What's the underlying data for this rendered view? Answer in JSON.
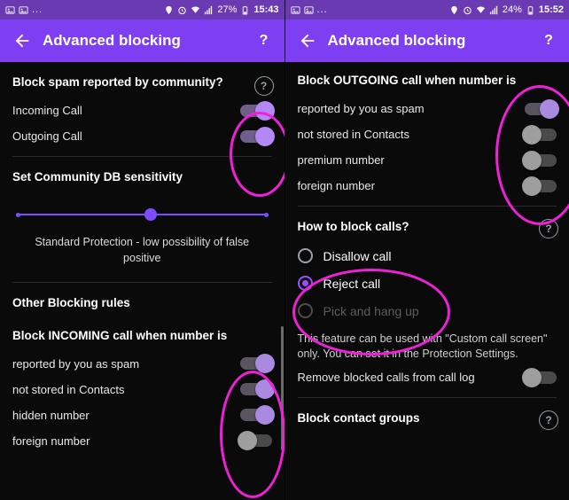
{
  "left_phone": {
    "statusbar": {
      "icons_left": [
        "image-icon",
        "image-icon",
        "overflow-dots-icon"
      ],
      "dots": "...",
      "icons_right": [
        "location-icon",
        "alarm-icon",
        "wifi-icon",
        "signal-icon"
      ],
      "battery_percent": "27%",
      "time": "15:43"
    },
    "appbar": {
      "back_icon": "arrow-back-icon",
      "title": "Advanced blocking",
      "help_label": "?"
    },
    "sections": [
      {
        "heading": "Block spam reported by community?",
        "help_icon": "help-circle-icon",
        "rows": [
          {
            "label": "Incoming Call",
            "toggle": "on"
          },
          {
            "label": "Outgoing Call",
            "toggle": "on"
          }
        ]
      },
      {
        "heading": "Set Community DB sensitivity",
        "slider": {
          "value_percent": 55,
          "caption": "Standard Protection - low possibility of false positive",
          "tick_positions": [
            0,
            100
          ]
        }
      },
      {
        "heading": "Other Blocking rules"
      },
      {
        "heading": "Block INCOMING call when number is",
        "rows": [
          {
            "label": "reported by you as spam",
            "toggle": "on"
          },
          {
            "label": "not stored in Contacts",
            "toggle": "on"
          },
          {
            "label": "hidden number",
            "toggle": "on"
          },
          {
            "label": "foreign number",
            "toggle": "off"
          }
        ]
      }
    ]
  },
  "right_phone": {
    "statusbar": {
      "icons_left": [
        "image-icon",
        "image-icon",
        "overflow-dots-icon"
      ],
      "dots": "...",
      "icons_right": [
        "location-icon",
        "alarm-icon",
        "wifi-icon",
        "signal-icon"
      ],
      "battery_percent": "24%",
      "time": "15:52"
    },
    "appbar": {
      "back_icon": "arrow-back-icon",
      "title": "Advanced blocking",
      "help_label": "?"
    },
    "sections": [
      {
        "heading": "Block OUTGOING call when number is",
        "rows": [
          {
            "label": "reported by you as spam",
            "toggle": "on"
          },
          {
            "label": "not stored in Contacts",
            "toggle": "off"
          },
          {
            "label": "premium number",
            "toggle": "off"
          },
          {
            "label": "foreign number",
            "toggle": "off"
          }
        ]
      },
      {
        "heading": "How to block calls?",
        "help_icon": "help-circle-icon",
        "radios": [
          {
            "label": "Disallow call",
            "state": "unselected"
          },
          {
            "label": "Reject call",
            "state": "selected"
          },
          {
            "label": "Pick and hang up",
            "state": "disabled"
          }
        ],
        "note": "This feature can be used with \"Custom call screen\" only. You can set it in the Protection Settings.",
        "rows": [
          {
            "label": "Remove blocked calls from call log",
            "toggle": "off"
          }
        ]
      },
      {
        "heading": "Block contact groups",
        "help_icon": "help-circle-icon"
      }
    ]
  },
  "annotations": {
    "highlight_color": "#f020d8",
    "shape": "ellipse"
  }
}
